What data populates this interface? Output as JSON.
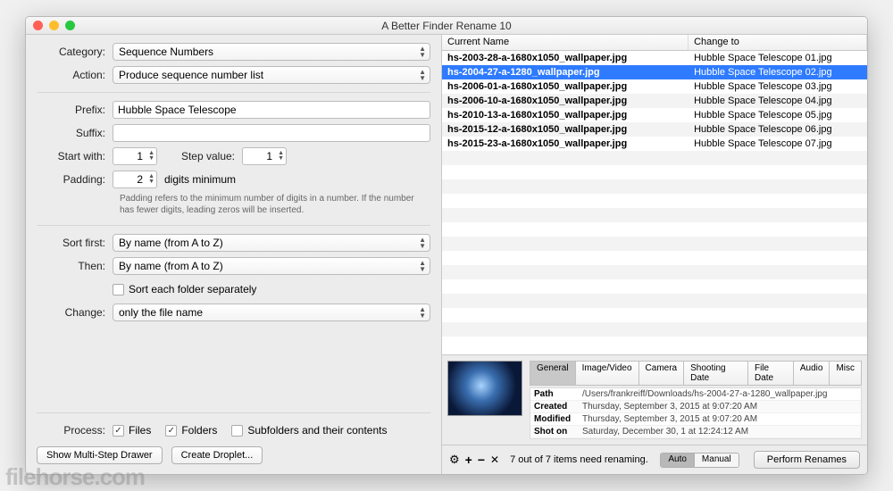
{
  "window": {
    "title": "A Better Finder Rename 10"
  },
  "form": {
    "category_label": "Category:",
    "category_value": "Sequence Numbers",
    "action_label": "Action:",
    "action_value": "Produce sequence number list",
    "prefix_label": "Prefix:",
    "prefix_value": "Hubble Space Telescope",
    "suffix_label": "Suffix:",
    "suffix_value": "",
    "startwith_label": "Start with:",
    "startwith_value": "1",
    "stepvalue_label": "Step value:",
    "stepvalue_value": "1",
    "padding_label": "Padding:",
    "padding_value": "2",
    "padding_unit": "digits minimum",
    "padding_hint": "Padding refers to the minimum number of digits in a number. If the number has fewer digits, leading zeros will be inserted.",
    "sortfirst_label": "Sort first:",
    "sortfirst_value": "By name (from A to Z)",
    "then_label": "Then:",
    "then_value": "By name (from A to Z)",
    "sortfolders_label": "Sort each folder separately",
    "change_label": "Change:",
    "change_value": "only the file name",
    "process_label": "Process:",
    "files_label": "Files",
    "folders_label": "Folders",
    "subfolders_label": "Subfolders and their contents",
    "showdrawer_label": "Show Multi-Step Drawer",
    "createdroplet_label": "Create Droplet..."
  },
  "table": {
    "col1": "Current Name",
    "col2": "Change to",
    "rows": [
      {
        "a": "hs-2003-28-a-1680x1050_wallpaper.jpg",
        "b": "Hubble Space Telescope 01.jpg",
        "sel": false
      },
      {
        "a": "hs-2004-27-a-1280_wallpaper.jpg",
        "b": "Hubble Space Telescope 02.jpg",
        "sel": true
      },
      {
        "a": "hs-2006-01-a-1680x1050_wallpaper.jpg",
        "b": "Hubble Space Telescope 03.jpg",
        "sel": false
      },
      {
        "a": "hs-2006-10-a-1680x1050_wallpaper.jpg",
        "b": "Hubble Space Telescope 04.jpg",
        "sel": false
      },
      {
        "a": "hs-2010-13-a-1680x1050_wallpaper.jpg",
        "b": "Hubble Space Telescope 05.jpg",
        "sel": false
      },
      {
        "a": "hs-2015-12-a-1680x1050_wallpaper.jpg",
        "b": "Hubble Space Telescope 06.jpg",
        "sel": false
      },
      {
        "a": "hs-2015-23-a-1680x1050_wallpaper.jpg",
        "b": "Hubble Space Telescope 07.jpg",
        "sel": false
      }
    ]
  },
  "preview": {
    "tabs": [
      "General",
      "Image/Video",
      "Camera",
      "Shooting Date",
      "File Date",
      "Audio",
      "Misc"
    ],
    "active_tab": 0,
    "path_k": "Path",
    "path_v": "/Users/frankreiff/Downloads/hs-2004-27-a-1280_wallpaper.jpg",
    "created_k": "Created",
    "created_v": "Thursday, September 3, 2015 at 9:07:20 AM",
    "modified_k": "Modified",
    "modified_v": "Thursday, September 3, 2015 at 9:07:20 AM",
    "shoton_k": "Shot on",
    "shoton_v": "Saturday, December 30, 1 at 12:24:12 AM"
  },
  "footer": {
    "status": "7 out of 7 items need renaming.",
    "auto": "Auto",
    "manual": "Manual",
    "perform": "Perform Renames"
  },
  "watermark": "filehorse.com"
}
